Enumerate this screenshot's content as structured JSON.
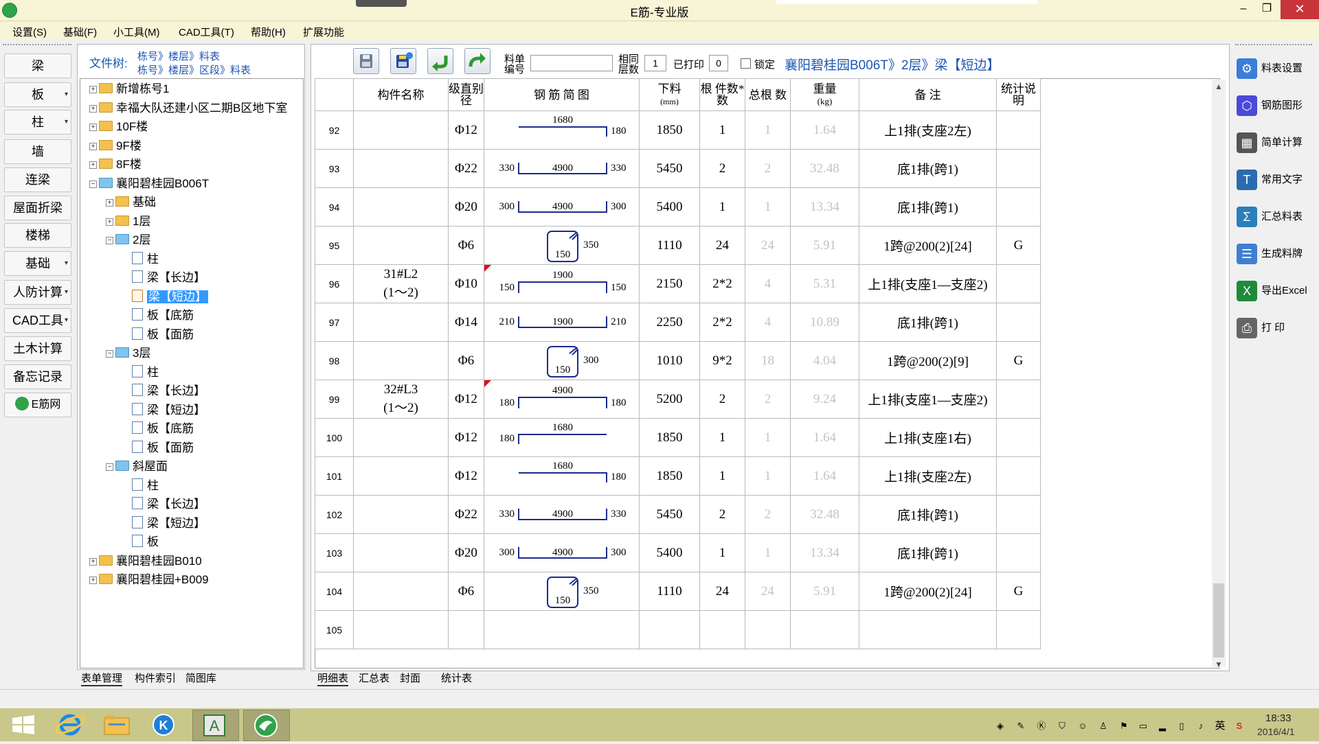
{
  "window": {
    "title": "E筋-专业版",
    "minimize": "–",
    "maximize": "❐",
    "close": "✕"
  },
  "menu": [
    "设置(S)",
    "基础(F)",
    "小工具(M)",
    "CAD工具(T)",
    "帮助(H)",
    "扩展功能"
  ],
  "left_buttons": [
    {
      "label": "梁",
      "dropdown": false
    },
    {
      "label": "板",
      "dropdown": true
    },
    {
      "label": "柱",
      "dropdown": true
    },
    {
      "label": "墙",
      "dropdown": false
    },
    {
      "label": "连梁",
      "dropdown": false
    },
    {
      "label": "屋面折梁",
      "dropdown": false
    },
    {
      "label": "楼梯",
      "dropdown": false
    },
    {
      "label": "基础",
      "dropdown": true
    },
    {
      "label": "人防计算",
      "dropdown": true
    },
    {
      "label": "CAD工具",
      "dropdown": true
    },
    {
      "label": "土木计算",
      "dropdown": false
    },
    {
      "label": "备忘记录",
      "dropdown": false
    },
    {
      "label": "E筋网",
      "dropdown": false
    }
  ],
  "tree": {
    "label": "文件树:",
    "path_line1": "栋号》楼层》料表",
    "path_line2": "栋号》楼层》区段》料表",
    "nodes": [
      {
        "text": "新增栋号1",
        "icon": "folder"
      },
      {
        "text": "幸福大队还建小区二期B区地下室",
        "icon": "folder"
      },
      {
        "text": "10F楼",
        "icon": "folder"
      },
      {
        "text": "9F楼",
        "icon": "folder"
      },
      {
        "text": "8F楼",
        "icon": "folder"
      },
      {
        "text": "襄阳碧桂园B006T",
        "icon": "folder-open"
      },
      {
        "text": "基础",
        "icon": "folder"
      },
      {
        "text": "1层",
        "icon": "folder"
      },
      {
        "text": "2层",
        "icon": "folder-open"
      },
      {
        "text": "柱",
        "icon": "doc"
      },
      {
        "text": "梁【长边】",
        "icon": "doc"
      },
      {
        "text": "梁【短边】",
        "icon": "doc-edit"
      },
      {
        "text": "板【底筋",
        "icon": "doc"
      },
      {
        "text": "板【面筋",
        "icon": "doc"
      },
      {
        "text": "3层",
        "icon": "folder-open"
      },
      {
        "text": "柱",
        "icon": "doc"
      },
      {
        "text": "梁【长边】",
        "icon": "doc"
      },
      {
        "text": "梁【短边】",
        "icon": "doc"
      },
      {
        "text": "板【底筋",
        "icon": "doc"
      },
      {
        "text": "板【面筋",
        "icon": "doc"
      },
      {
        "text": "斜屋面",
        "icon": "folder-open"
      },
      {
        "text": "柱",
        "icon": "doc"
      },
      {
        "text": "梁【长边】",
        "icon": "doc"
      },
      {
        "text": "梁【短边】",
        "icon": "doc"
      },
      {
        "text": "板",
        "icon": "doc"
      },
      {
        "text": "襄阳碧桂园B010",
        "icon": "folder"
      },
      {
        "text": "襄阳碧桂园+B009",
        "icon": "folder"
      }
    ],
    "selected_index": 11,
    "tabs": [
      "表单管理",
      "构件索引",
      "简图库"
    ]
  },
  "toolbar": {
    "list_no_label_1": "料单",
    "list_no_label_2": "编号",
    "list_no_value": "",
    "same_floor_label_1": "相同",
    "same_floor_label_2": "层数",
    "same_floor_value": "1",
    "printed_label": "已打印",
    "printed_value": "0",
    "lock_label": "锁定",
    "breadcrumb": "襄阳碧桂园B006T》2层》梁【短边】",
    "icons": [
      "save-icon",
      "save-as-icon",
      "undo-icon",
      "redo-icon"
    ]
  },
  "table": {
    "headers": {
      "name": "构件名称",
      "grade": "级直别径",
      "diagram": "钢 筋 简 图",
      "cut_length": "下料",
      "cut_length_unit": "(mm)",
      "count": "根 件数*数",
      "total": "总根 数",
      "weight": "重量",
      "weight_unit": "(kg)",
      "remark": "备      注",
      "stat": "统计说明"
    },
    "rows": [
      {
        "no": "92",
        "name": "",
        "grade": "Φ12",
        "shape": "hook_right",
        "d_left": "",
        "d_top": "1680",
        "d_right": "180",
        "length": "1850",
        "count": "1",
        "total": "1",
        "weight": "1.64",
        "remark": "上1排(支座2左)",
        "stat": "",
        "marker": false
      },
      {
        "no": "93",
        "name": "",
        "grade": "Φ22",
        "shape": "u",
        "d_left": "330",
        "d_top": "4900",
        "d_right": "330",
        "length": "5450",
        "count": "2",
        "total": "2",
        "weight": "32.48",
        "remark": "底1排(跨1)",
        "stat": "",
        "marker": false
      },
      {
        "no": "94",
        "name": "",
        "grade": "Φ20",
        "shape": "u",
        "d_left": "300",
        "d_top": "4900",
        "d_right": "300",
        "length": "5400",
        "count": "1",
        "total": "1",
        "weight": "13.34",
        "remark": "底1排(跨1)",
        "stat": "",
        "marker": false
      },
      {
        "no": "95",
        "name": "",
        "grade": "Φ6",
        "shape": "stirrup",
        "d_left": "",
        "d_top": "150",
        "d_right": "350",
        "length": "1110",
        "count": "24",
        "total": "24",
        "weight": "5.91",
        "remark": "1跨@200(2)[24]",
        "stat": "G",
        "marker": false
      },
      {
        "no": "96",
        "name": "31#L2\n(1～2)",
        "grade": "Φ10",
        "shape": "cap",
        "d_left": "150",
        "d_top": "1900",
        "d_right": "150",
        "length": "2150",
        "count": "2*2",
        "total": "4",
        "weight": "5.31",
        "remark": "上1排(支座1—支座2)",
        "stat": "",
        "marker": true
      },
      {
        "no": "97",
        "name": "",
        "grade": "Φ14",
        "shape": "u",
        "d_left": "210",
        "d_top": "1900",
        "d_right": "210",
        "length": "2250",
        "count": "2*2",
        "total": "4",
        "weight": "10.89",
        "remark": "底1排(跨1)",
        "stat": "",
        "marker": false
      },
      {
        "no": "98",
        "name": "",
        "grade": "Φ6",
        "shape": "stirrup",
        "d_left": "",
        "d_top": "150",
        "d_right": "300",
        "length": "1010",
        "count": "9*2",
        "total": "18",
        "weight": "4.04",
        "remark": "1跨@200(2)[9]",
        "stat": "G",
        "marker": false
      },
      {
        "no": "99",
        "name": "32#L3\n(1～2)",
        "grade": "Φ12",
        "shape": "cap",
        "d_left": "180",
        "d_top": "4900",
        "d_right": "180",
        "length": "5200",
        "count": "2",
        "total": "2",
        "weight": "9.24",
        "remark": "上1排(支座1—支座2)",
        "stat": "",
        "marker": true
      },
      {
        "no": "100",
        "name": "",
        "grade": "Φ12",
        "shape": "hook_left",
        "d_left": "180",
        "d_top": "1680",
        "d_right": "",
        "length": "1850",
        "count": "1",
        "total": "1",
        "weight": "1.64",
        "remark": "上1排(支座1右)",
        "stat": "",
        "marker": false
      },
      {
        "no": "101",
        "name": "",
        "grade": "Φ12",
        "shape": "hook_right",
        "d_left": "",
        "d_top": "1680",
        "d_right": "180",
        "length": "1850",
        "count": "1",
        "total": "1",
        "weight": "1.64",
        "remark": "上1排(支座2左)",
        "stat": "",
        "marker": false
      },
      {
        "no": "102",
        "name": "",
        "grade": "Φ22",
        "shape": "u",
        "d_left": "330",
        "d_top": "4900",
        "d_right": "330",
        "length": "5450",
        "count": "2",
        "total": "2",
        "weight": "32.48",
        "remark": "底1排(跨1)",
        "stat": "",
        "marker": false
      },
      {
        "no": "103",
        "name": "",
        "grade": "Φ20",
        "shape": "u",
        "d_left": "300",
        "d_top": "4900",
        "d_right": "300",
        "length": "5400",
        "count": "1",
        "total": "1",
        "weight": "13.34",
        "remark": "底1排(跨1)",
        "stat": "",
        "marker": false
      },
      {
        "no": "104",
        "name": "",
        "grade": "Φ6",
        "shape": "stirrup",
        "d_left": "",
        "d_top": "150",
        "d_right": "350",
        "length": "1110",
        "count": "24",
        "total": "24",
        "weight": "5.91",
        "remark": "1跨@200(2)[24]",
        "stat": "G",
        "marker": false
      },
      {
        "no": "105",
        "name": "",
        "grade": "",
        "shape": "none",
        "d_left": "",
        "d_top": "",
        "d_right": "",
        "length": "",
        "count": "",
        "total": "",
        "weight": "",
        "remark": "",
        "stat": "",
        "marker": false
      }
    ],
    "tabs": [
      "明细表",
      "汇总表",
      "封面",
      "统计表"
    ]
  },
  "right_tools": [
    {
      "label": "料表设置",
      "icon": "gear-icon",
      "color": "#3b7dd8"
    },
    {
      "label": "钢筋图形",
      "icon": "shape-icon",
      "color": "#4a4ad8"
    },
    {
      "label": "简单计算",
      "icon": "calculator-icon",
      "color": "#555555"
    },
    {
      "label": "常用文字",
      "icon": "text-icon",
      "color": "#2b6cb0"
    },
    {
      "label": "汇总料表",
      "icon": "sigma-icon",
      "color": "#2c7fb8"
    },
    {
      "label": "生成料牌",
      "icon": "list-icon",
      "color": "#3f7fd0"
    },
    {
      "label": "导出Excel",
      "icon": "excel-icon",
      "color": "#1f8a3a"
    },
    {
      "label": "打 印",
      "icon": "printer-icon",
      "color": "#666666"
    }
  ],
  "taskbar": {
    "apps": [
      "windows-start-icon",
      "ie-icon",
      "explorer-icon",
      "k-app-icon",
      "autocad-icon",
      "ejin-icon"
    ],
    "tray_ime": "英",
    "time": "18:33",
    "date": "2016/4/1"
  },
  "colors": {
    "accent_blue": "#1c56b4",
    "rebar_line": "#1a2b8c",
    "selection": "#3399ff",
    "title_bar": "#f7f5d6",
    "close_red": "#c7343a"
  }
}
